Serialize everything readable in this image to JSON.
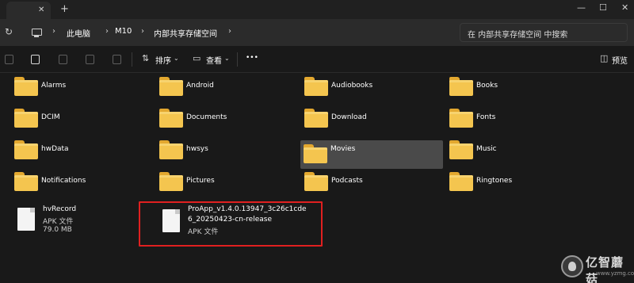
{
  "window": {
    "controls": [
      "—",
      "☐",
      "✕"
    ]
  },
  "address": {
    "crumbs": [
      "此电脑",
      "M10",
      "内部共享存储空间"
    ],
    "search_placeholder": "在 内部共享存储空间 中搜索"
  },
  "toolbar": {
    "sort_label": "排序",
    "view_label": "查看",
    "more_label": "•••",
    "preview_label": "预览"
  },
  "folders": [
    {
      "name": "Alarms",
      "selected": false
    },
    {
      "name": "Android",
      "selected": false
    },
    {
      "name": "Audiobooks",
      "selected": false
    },
    {
      "name": "Books",
      "selected": false
    },
    {
      "name": "DCIM",
      "selected": false
    },
    {
      "name": "Documents",
      "selected": false
    },
    {
      "name": "Download",
      "selected": false
    },
    {
      "name": "Fonts",
      "selected": false
    },
    {
      "name": "hwData",
      "selected": false
    },
    {
      "name": "hwsys",
      "selected": false
    },
    {
      "name": "Movies",
      "selected": true
    },
    {
      "name": "Music",
      "selected": false
    },
    {
      "name": "Notifications",
      "selected": false
    },
    {
      "name": "Pictures",
      "selected": false
    },
    {
      "name": "Podcasts",
      "selected": false
    },
    {
      "name": "Ringtones",
      "selected": false
    }
  ],
  "files": [
    {
      "name": "hvRecord",
      "type": "APK 文件",
      "size": "79.0 MB"
    },
    {
      "name_line1": "ProApp_v1.4.0.13947_3c26c1cde",
      "name_line2": "6_20250423-cn-release",
      "type": "APK 文件"
    }
  ],
  "watermark": {
    "text": "亿智蘑菇",
    "sub": "www.yzmg.com"
  },
  "colors": {
    "background": "#191919",
    "folder": "#f4c54f",
    "highlight": "#e02020",
    "selection": "#4a4a4a"
  }
}
